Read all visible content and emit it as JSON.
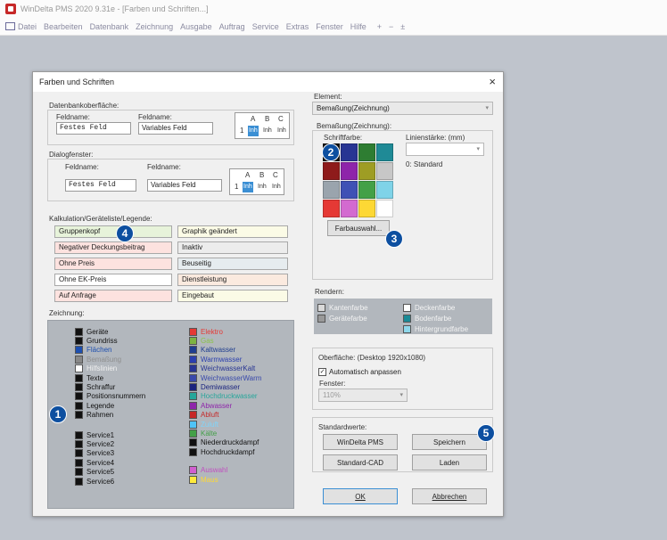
{
  "window": {
    "title": "WinDelta PMS 2020 9.31e - [Farben und Schriften...]"
  },
  "menu": [
    "Datei",
    "Bearbeiten",
    "Datenbank",
    "Zeichnung",
    "Ausgabe",
    "Auftrag",
    "Service",
    "Extras",
    "Fenster",
    "Hilfe",
    "+",
    "−",
    "±"
  ],
  "dialog": {
    "title": "Farben und Schriften",
    "db": {
      "label": "Datenbankoberfläche:",
      "fieldname1": "Feldname:",
      "value1": "Festes Feld",
      "fieldname2": "Feldname:",
      "value2": "Variables Feld",
      "abc": {
        "a": "A",
        "b": "B",
        "c": "C",
        "num": "1",
        "cells": [
          "Inh",
          "Inh",
          "Inh"
        ]
      }
    },
    "dialogwin": {
      "label": "Dialogfenster:",
      "fieldname1": "Feldname:",
      "value1": "Festes Feld",
      "fieldname2": "Feldname:",
      "value2": "Variables Feld",
      "abc": {
        "a": "A",
        "b": "B",
        "c": "C",
        "num": "1",
        "cells": [
          "Inh",
          "Inh",
          "Inh"
        ]
      }
    },
    "calc": {
      "label": "Kalkulation/Geräteliste/Legende:",
      "items": [
        {
          "text": "Gruppenkopf",
          "bg": "#e7f3da"
        },
        {
          "text": "Graphik geändert",
          "bg": "#fbfbe6"
        },
        {
          "text": "Negativer Deckungsbeitrag",
          "bg": "#fde2df"
        },
        {
          "text": "Inaktiv",
          "bg": "#ececec"
        },
        {
          "text": "Ohne Preis",
          "bg": "#fde2df"
        },
        {
          "text": "Beuseitig",
          "bg": "#e6ecef"
        },
        {
          "text": "Ohne EK-Preis",
          "bg": "#ffffff"
        },
        {
          "text": "Dienstleistung",
          "bg": "#fbeadf"
        },
        {
          "text": "Auf Anfrage",
          "bg": "#fde2df"
        },
        {
          "text": "Eingebaut",
          "bg": "#fbfbe6"
        }
      ]
    },
    "zeichnung": {
      "label": "Zeichnung:",
      "left": [
        {
          "text": "Geräte",
          "sw": "#111",
          "tc": "#111"
        },
        {
          "text": "Grundriss",
          "sw": "#111",
          "tc": "#111"
        },
        {
          "text": "Flächen",
          "sw": "#1d4fb0",
          "tc": "#1d4fb0"
        },
        {
          "text": "Bemaßung",
          "sw": "#888",
          "tc": "#8f8f8f"
        },
        {
          "text": "Hilfslinien",
          "sw": "#fff",
          "tc": "#f1f1f1"
        },
        {
          "text": "Texte",
          "sw": "#111",
          "tc": "#111"
        },
        {
          "text": "Schraffur",
          "sw": "#111",
          "tc": "#111"
        },
        {
          "text": "Positionsnummern",
          "sw": "#111",
          "tc": "#111"
        },
        {
          "text": "Legende",
          "sw": "#111",
          "tc": "#111"
        },
        {
          "text": "Rahmen",
          "sw": "#111",
          "tc": "#111"
        },
        {
          "text": "Service1",
          "sw": "#111",
          "tc": "#111"
        },
        {
          "text": "Service2",
          "sw": "#111",
          "tc": "#111"
        },
        {
          "text": "Service3",
          "sw": "#111",
          "tc": "#111"
        },
        {
          "text": "Service4",
          "sw": "#111",
          "tc": "#111"
        },
        {
          "text": "Service5",
          "sw": "#111",
          "tc": "#111"
        },
        {
          "text": "Service6",
          "sw": "#111",
          "tc": "#111"
        }
      ],
      "right": [
        {
          "text": "Elektro",
          "sw": "#e53935",
          "tc": "#e53935"
        },
        {
          "text": "Gas",
          "sw": "#7cb342",
          "tc": "#8bc34a"
        },
        {
          "text": "Kaltwasser",
          "sw": "#1f3d8f",
          "tc": "#1f3d8f"
        },
        {
          "text": "Warmwasser",
          "sw": "#2b3fae",
          "tc": "#2b3fae"
        },
        {
          "text": "WeichwasserKalt",
          "sw": "#283593",
          "tc": "#283593"
        },
        {
          "text": "WeichwasserWarm",
          "sw": "#3949ab",
          "tc": "#3949ab"
        },
        {
          "text": "Demiwasser",
          "sw": "#1a237e",
          "tc": "#1a237e"
        },
        {
          "text": "Hochdruckwasser",
          "sw": "#26a69a",
          "tc": "#26a69a"
        },
        {
          "text": "Abwasser",
          "sw": "#8e24aa",
          "tc": "#8e24aa"
        },
        {
          "text": "Abluft",
          "sw": "#c62828",
          "tc": "#c62828"
        },
        {
          "text": "Zuluft",
          "sw": "#4fc3f7",
          "tc": "#81d4fa"
        },
        {
          "text": "Kälte",
          "sw": "#43a047",
          "tc": "#43a047"
        },
        {
          "text": "Niederdruckdampf",
          "sw": "#111",
          "tc": "#111"
        },
        {
          "text": "Hochdruckdampf",
          "sw": "#111",
          "tc": "#111"
        },
        {
          "text": "Auswahl",
          "sw": "#d15fd0",
          "tc": "#c050c0"
        },
        {
          "text": "Maus",
          "sw": "#ffeb3b",
          "tc": "#fdd835"
        }
      ]
    },
    "element": {
      "label": "Element:",
      "value": "Bemaßung(Zeichnung)"
    },
    "bemassung": {
      "label": "Bemaßung(Zeichnung):",
      "schriftfarbe": "Schriftfarbe:",
      "linienstaerke": "Linienstärke: (mm)",
      "standard": "0: Standard",
      "farbauswahl": "Farbauswahl...",
      "palette": [
        "#111111",
        "#283593",
        "#2e7d32",
        "#1f8a96",
        "#8e1b1b",
        "#8e24aa",
        "#9e9d24",
        "#c7c7c7",
        "#9aa4ad",
        "#3f51b5",
        "#43a047",
        "#7fd3e8",
        "#e53935",
        "#d36ad0",
        "#fdd835",
        "#ffffff"
      ]
    },
    "rendern": {
      "label": "Rendern:",
      "items": [
        {
          "text": "Kantenfarbe",
          "sw": "#d9d9d9"
        },
        {
          "text": "Deckenfarbe",
          "sw": "#ffffff"
        },
        {
          "text": "Gerätefarbe",
          "sw": "#999999"
        },
        {
          "text": "Bodenfarbe",
          "sw": "#1a8a96"
        },
        {
          "text": "Hintergrundfarbe",
          "sw": "#8ed7ea"
        }
      ]
    },
    "oberflaeche": {
      "label": "Oberfläche: (Desktop 1920x1080)",
      "auto": "Automatisch anpassen",
      "check": "✓",
      "fenster": "Fenster:",
      "value": "110%"
    },
    "standardwerte": {
      "label": "Standardwerte:",
      "b1": "WinDelta PMS",
      "b2": "Speichern",
      "b3": "Standard-CAD",
      "b4": "Laden"
    },
    "ok": "OK",
    "cancel": "Abbrechen",
    "close": "×",
    "arrow": "▾"
  },
  "badges": [
    "1",
    "2",
    "3",
    "4",
    "5"
  ]
}
